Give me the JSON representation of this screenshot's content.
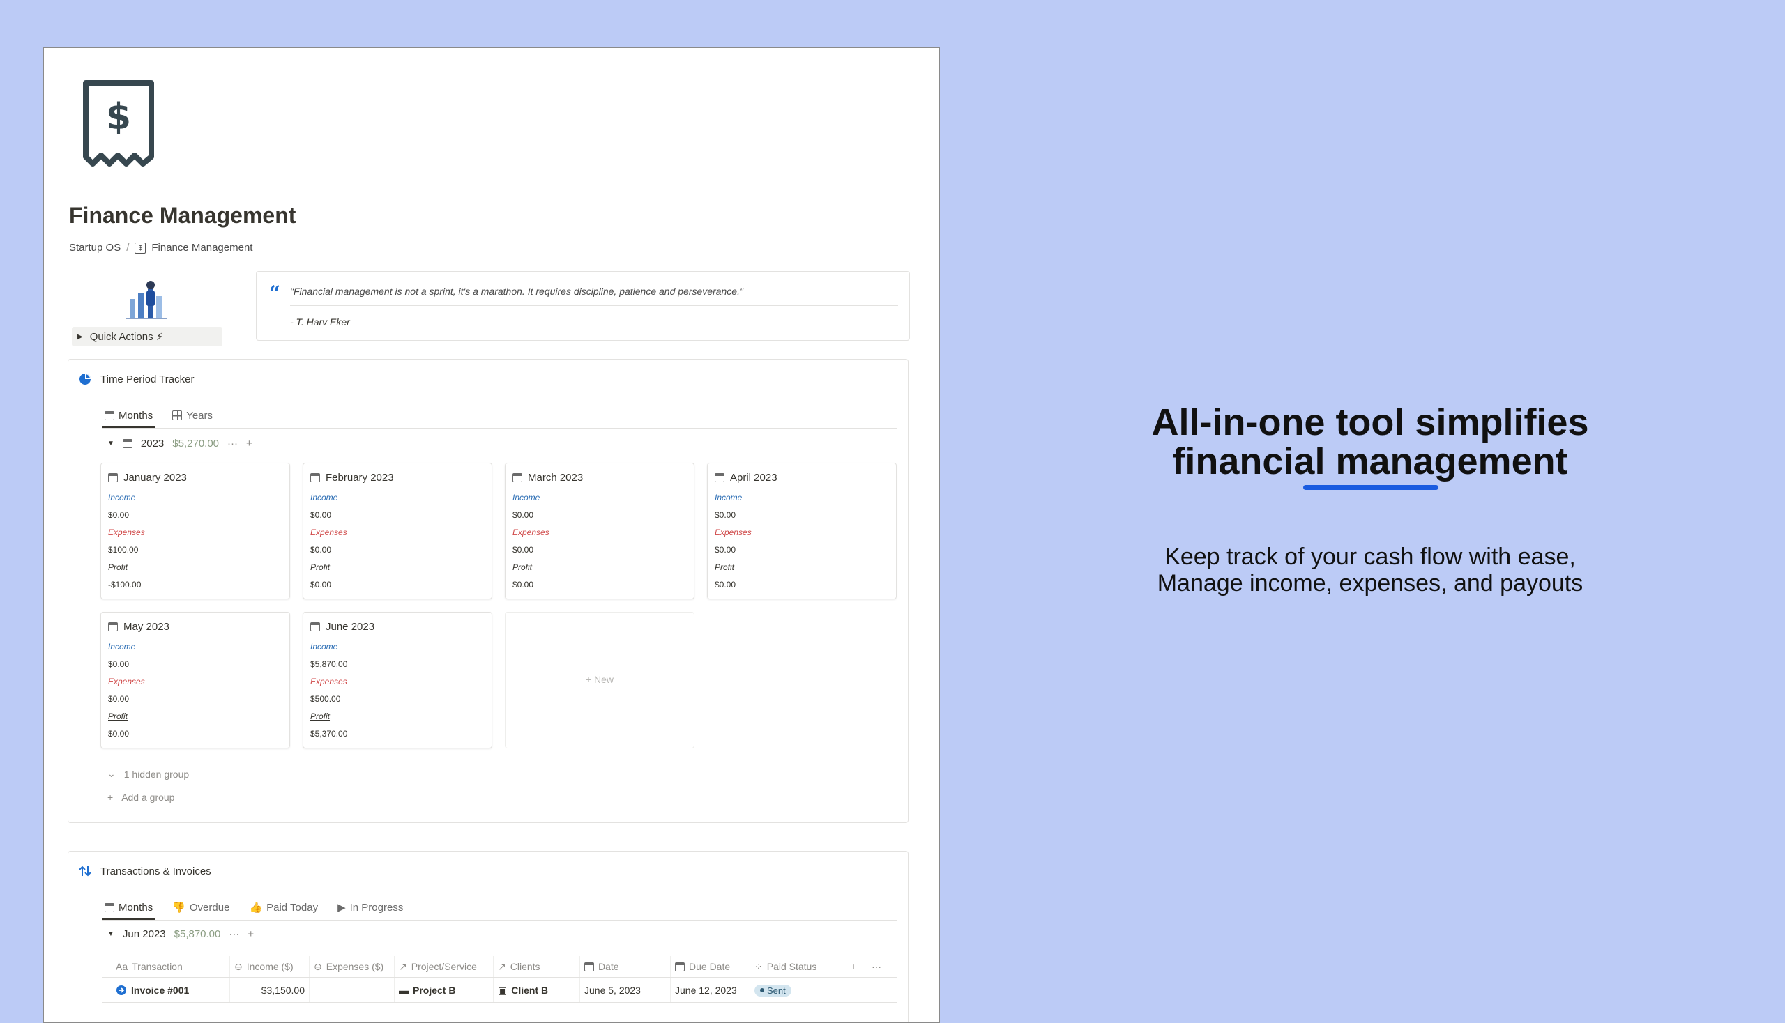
{
  "page": {
    "title": "Finance Management",
    "breadcrumb": [
      "Startup OS",
      "Finance Management"
    ],
    "breadcrumb_sep": "/",
    "quick_actions": "Quick Actions ⚡",
    "quote": {
      "text": "\"Financial management is not a sprint, it's a marathon. It requires discipline, patience and perseverance.\"",
      "author": "- T. Harv Eker"
    }
  },
  "time_tracker": {
    "title": "Time Period Tracker",
    "tabs": [
      "Months",
      "Years"
    ],
    "group": {
      "label": "2023",
      "total": "$5,270.00"
    },
    "labels": {
      "income": "Income",
      "expenses": "Expenses",
      "profit": "Profit"
    },
    "cards": [
      {
        "title": "January 2023",
        "income": "$0.00",
        "expenses": "$100.00",
        "profit": "-$100.00"
      },
      {
        "title": "February 2023",
        "income": "$0.00",
        "expenses": "$0.00",
        "profit": "$0.00"
      },
      {
        "title": "March 2023",
        "income": "$0.00",
        "expenses": "$0.00",
        "profit": "$0.00"
      },
      {
        "title": "April 2023",
        "income": "$0.00",
        "expenses": "$0.00",
        "profit": "$0.00"
      },
      {
        "title": "May 2023",
        "income": "$0.00",
        "expenses": "$0.00",
        "profit": "$0.00"
      },
      {
        "title": "June 2023",
        "income": "$5,870.00",
        "expenses": "$500.00",
        "profit": "$5,370.00"
      }
    ],
    "new_label": "+ New",
    "hidden_group": "1 hidden group",
    "add_group": "Add a group"
  },
  "transactions": {
    "title": "Transactions & Invoices",
    "tabs": [
      "Months",
      "Overdue",
      "Paid Today",
      "In Progress"
    ],
    "group": {
      "label": "Jun 2023",
      "total": "$5,870.00"
    },
    "columns": [
      "Transaction",
      "Income ($)",
      "Expenses ($)",
      "Project/Service",
      "Clients",
      "Date",
      "Due Date",
      "Paid Status"
    ],
    "rows": [
      {
        "transaction": "Invoice #001",
        "income": "$3,150.00",
        "expenses": "",
        "project": "Project B",
        "client": "Client B",
        "date": "June 5, 2023",
        "due": "June 12, 2023",
        "status": "Sent"
      }
    ]
  },
  "marketing": {
    "headline_line1": "All-in-one tool simplifies",
    "headline_line2": "financial management",
    "sub_line1": "Keep track of your cash flow with ease,",
    "sub_line2": "Manage income, expenses, and payouts"
  },
  "colors": {
    "background": "#bccbf6",
    "accent": "#1a5be0",
    "income": "#2e6fb5",
    "expenses": "#d04a4a"
  }
}
